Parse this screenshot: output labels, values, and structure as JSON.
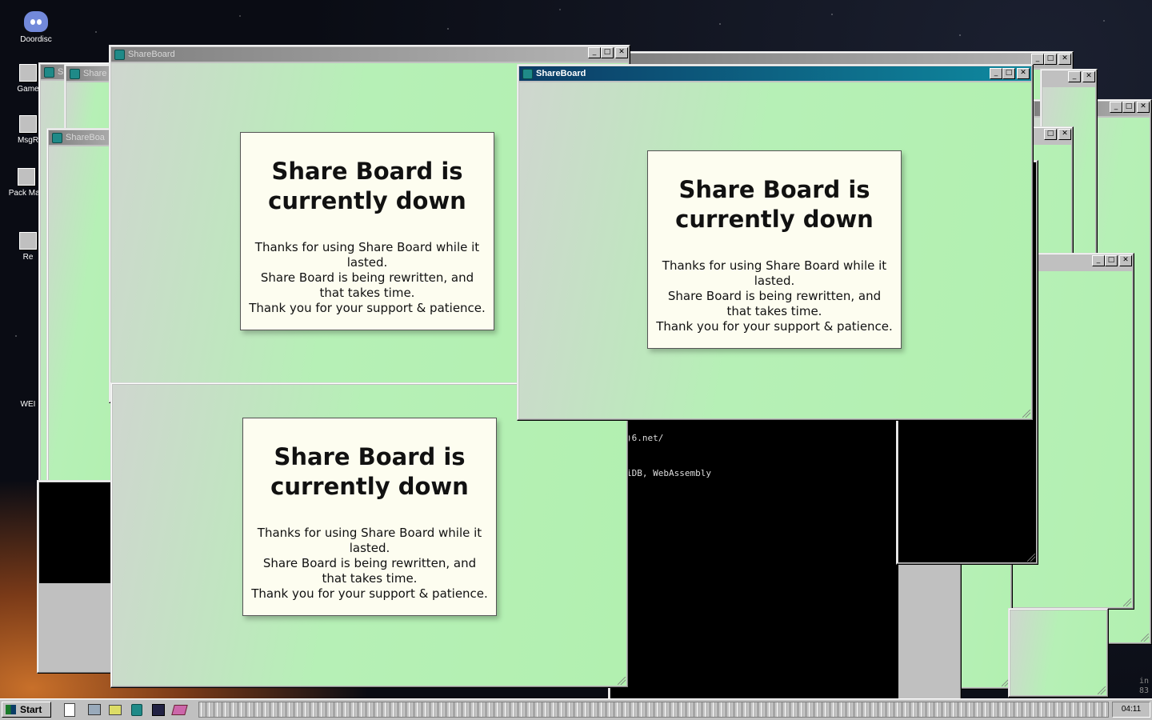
{
  "desktop": {
    "icons": [
      {
        "label": "Doordisc"
      },
      {
        "label": "Game"
      },
      {
        "label": "MsgR"
      },
      {
        "label": "Pack Man"
      },
      {
        "label": "Re"
      },
      {
        "label": "WEI"
      }
    ]
  },
  "windows": {
    "app_title": "ShareBoard",
    "partial_titles": [
      "S",
      "Share",
      "ShareBoa"
    ],
    "controls": {
      "minimize": "_",
      "maximize": "□",
      "close": "✕"
    }
  },
  "notice": {
    "heading": "Share Board is currently down",
    "line1": "Thanks for using Share Board while it lasted.",
    "line2": "Share Board is being rewritten, and that takes time.",
    "line3": "Thank you for your support & patience."
  },
  "terminal": {
    "line1": ")6.net/",
    "line2": "iDB, WebAssembly",
    "edge_text": "in 83"
  },
  "taskbar": {
    "start_label": "Start",
    "clock": "04:11"
  }
}
